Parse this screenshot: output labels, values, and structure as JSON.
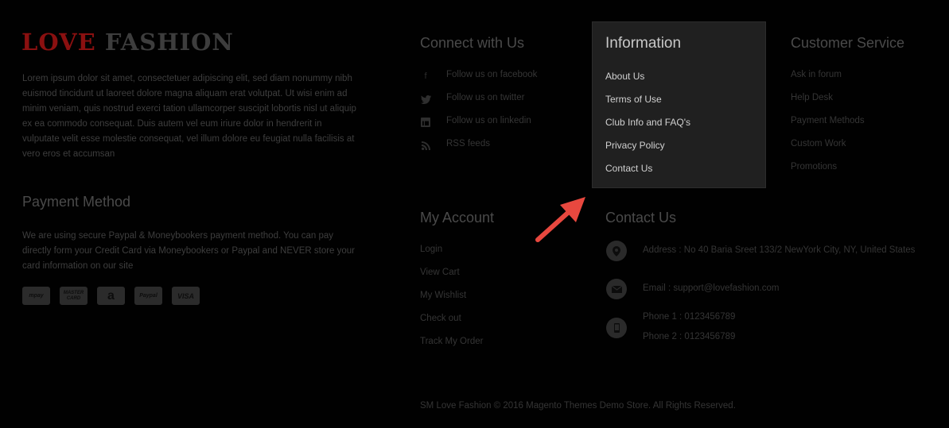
{
  "brand": {
    "part1": "LOVE",
    "part2": "FASHION"
  },
  "about_text": "Lorem ipsum dolor sit amet, consectetuer adipiscing elit, sed diam nonummy nibh euismod tincidunt ut laoreet dolore magna aliquam erat volutpat. Ut wisi enim ad minim veniam, quis nostrud exerci tation ullamcorper suscipit lobortis nisl ut aliquip ex ea commodo consequat. Duis autem vel eum iriure dolor in hendrerit in vulputate velit esse molestie consequat, vel illum dolore eu feugiat nulla facilisis at vero eros et accumsan",
  "payment": {
    "title": "Payment Method",
    "text": "We are using secure Paypal & Moneybookers payment method. You can pay directly form your Credit Card via Moneybookers or Paypal and NEVER store your card information on our site",
    "cards": [
      "mpay",
      "MASTER CARD",
      "a",
      "Paypal",
      "VISA"
    ]
  },
  "connect": {
    "title": "Connect with Us",
    "items": [
      {
        "label": "Follow us on facebook",
        "icon": "f"
      },
      {
        "label": "Follow us on twitter",
        "icon": "t"
      },
      {
        "label": "Follow us on linkedin",
        "icon": "in"
      },
      {
        "label": "RSS feeds",
        "icon": "rss"
      }
    ]
  },
  "information": {
    "title": "Information",
    "items": [
      "About Us",
      "Terms of Use",
      "Club Info and FAQ's",
      "Privacy Policy",
      "Contact Us"
    ]
  },
  "customer_service": {
    "title": "Customer Service",
    "items": [
      "Ask in forum",
      "Help Desk",
      "Payment Methods",
      "Custom Work",
      "Promotions"
    ]
  },
  "account": {
    "title": "My Account",
    "items": [
      "Login",
      "View Cart",
      "My Wishlist",
      "Check out",
      "Track My Order"
    ]
  },
  "contact": {
    "title": "Contact Us",
    "address": "Address : No 40 Baria Sreet 133/2 NewYork City, NY, United States",
    "email": "Email : support@lovefashion.com",
    "phone1": "Phone 1 : 0123456789",
    "phone2": "Phone 2 : 0123456789"
  },
  "footer": "SM Love Fashion © 2016 Magento Themes Demo Store. All Rights Reserved.",
  "colors": {
    "arrow": "#e8483f",
    "brand_red": "#8a1010",
    "info_bg": "#202020"
  }
}
